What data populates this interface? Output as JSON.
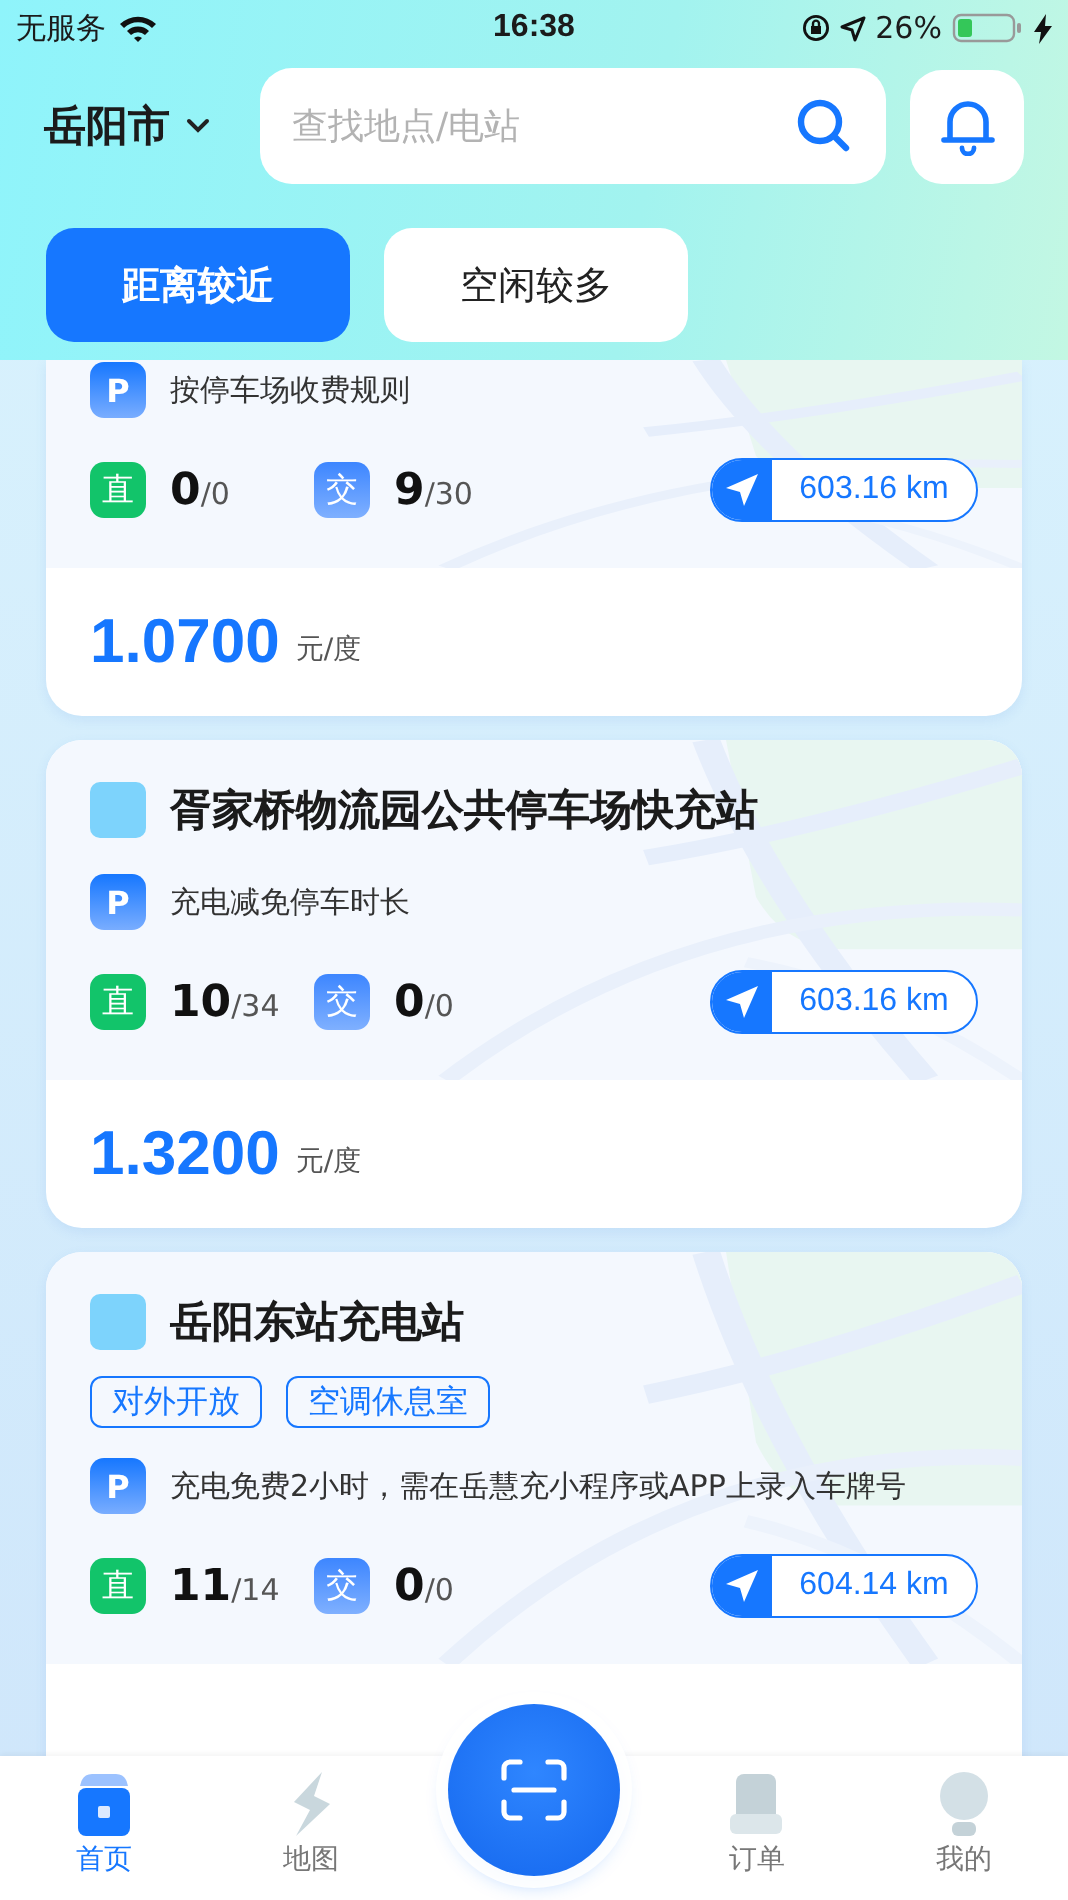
{
  "status_bar": {
    "carrier": "无服务",
    "time": "16:38",
    "battery": "26%"
  },
  "header": {
    "city": "岳阳市",
    "search": {
      "placeholder": "查找地点/电站"
    }
  },
  "sort_tabs": [
    {
      "label": "距离较近",
      "selected": true
    },
    {
      "label": "空闲较多",
      "selected": false
    }
  ],
  "stations": [
    {
      "parking_label": "P",
      "parking_note": "按停车场收费规则",
      "dc_label": "直",
      "dc_free": "0",
      "dc_total": "/0",
      "ac_label": "交",
      "ac_free": "9",
      "ac_total": "/30",
      "distance": "603.16 km",
      "price": "1.0700",
      "unit": "元/度"
    },
    {
      "name": "胥家桥物流园公共停车场快充站",
      "parking_label": "P",
      "parking_note": "充电减免停车时长",
      "dc_label": "直",
      "dc_free": "10",
      "dc_total": "/34",
      "ac_label": "交",
      "ac_free": "0",
      "ac_total": "/0",
      "distance": "603.16 km",
      "price": "1.3200",
      "unit": "元/度"
    },
    {
      "name": "岳阳东站充电站",
      "tags": [
        "对外开放",
        "空调休息室"
      ],
      "parking_label": "P",
      "parking_note": "充电免费2小时，需在岳慧充小程序或APP上录入车牌号",
      "dc_label": "直",
      "dc_free": "11",
      "dc_total": "/14",
      "ac_label": "交",
      "ac_free": "0",
      "ac_total": "/0",
      "distance": "604.14 km"
    }
  ],
  "tab_bar": [
    {
      "label": "首页",
      "kind": "home",
      "selected": true
    },
    {
      "label": "地图",
      "kind": "map",
      "selected": false
    },
    {
      "kind": "scan"
    },
    {
      "label": "订单",
      "kind": "orders",
      "selected": false
    },
    {
      "label": "我的",
      "kind": "profile",
      "selected": false
    }
  ]
}
